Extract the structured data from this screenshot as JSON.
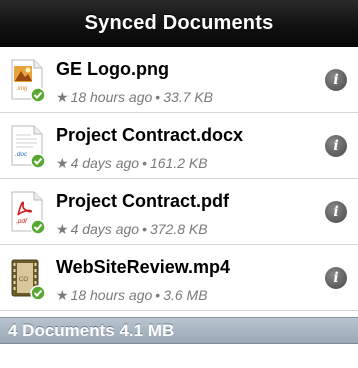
{
  "header": {
    "title": "Synced Documents"
  },
  "documents": [
    {
      "name": "GE Logo.png",
      "time": "18 hours ago",
      "size": "33.7 KB",
      "icon": "image-file-icon",
      "ext": ".img"
    },
    {
      "name": "Project Contract.docx",
      "time": "4 days ago",
      "size": "161.2 KB",
      "icon": "word-document-icon",
      "ext": ".doc"
    },
    {
      "name": "Project Contract.pdf",
      "time": "4 days ago",
      "size": "372.8 KB",
      "icon": "pdf-file-icon",
      "ext": ".pdf"
    },
    {
      "name": "WebSiteReview.mp4",
      "time": "18 hours ago",
      "size": "3.6 MB",
      "icon": "video-file-icon",
      "ext": ""
    }
  ],
  "footer": {
    "summary": "4 Documents 4.1 MB"
  },
  "colors": {
    "synced_check": "#5aa832",
    "titlebar": "#121212",
    "footer": "#9aa8b5"
  }
}
